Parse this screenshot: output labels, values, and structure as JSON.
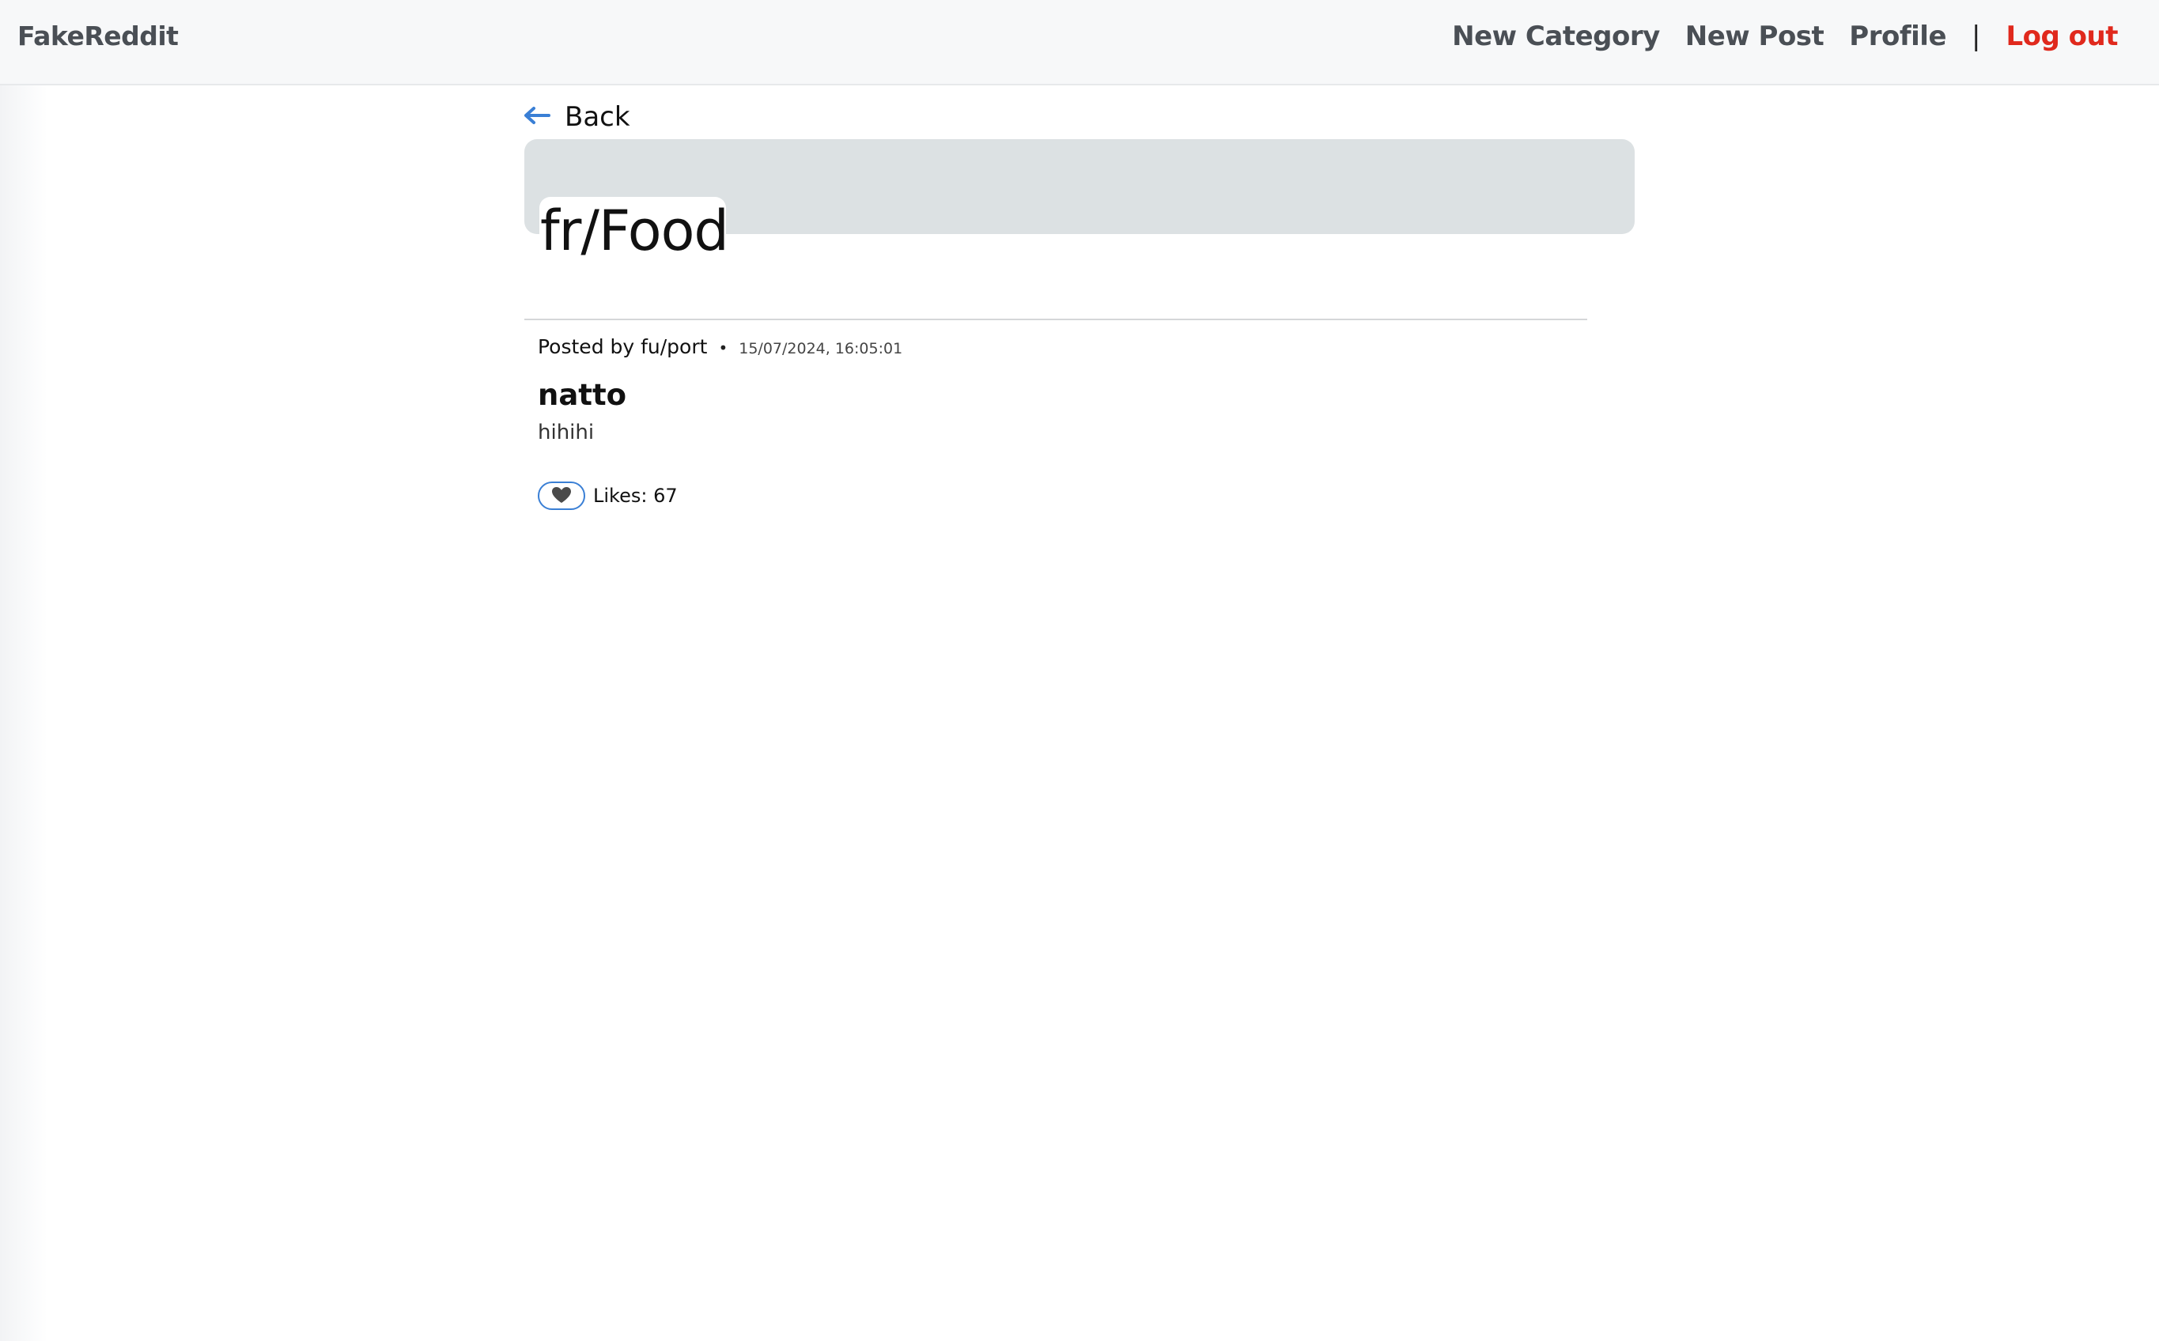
{
  "navbar": {
    "brand": "FakeReddit",
    "links": {
      "new_category": "New Category",
      "new_post": "New Post",
      "profile": "Profile",
      "separator": "|",
      "logout": "Log out"
    }
  },
  "back": {
    "label": "Back"
  },
  "category": {
    "title": "fr/Food"
  },
  "post": {
    "author": "Posted by fu/port",
    "separator": "•",
    "timestamp": "15/07/2024, 16:05:01",
    "title": "natto",
    "body": "hihihi",
    "likes_label": "Likes: 67"
  },
  "colors": {
    "nav_text": "#4a4f55",
    "logout": "#e0291d",
    "accent": "#3a7fd5",
    "banner": "#dce1e3"
  },
  "icons": {
    "back": "arrow-left-icon",
    "like": "heart-icon"
  }
}
